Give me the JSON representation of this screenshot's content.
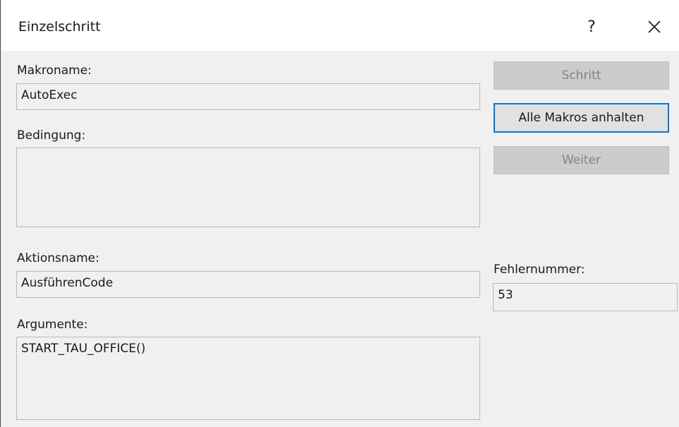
{
  "window": {
    "title": "Einzelschritt",
    "help_label": "?",
    "close_icon": "close-icon"
  },
  "fields": {
    "makroname_label": "Makroname:",
    "makroname_value": "AutoExec",
    "bedingung_label": "Bedingung:",
    "bedingung_value": "",
    "aktionsname_label": "Aktionsname:",
    "aktionsname_value": "AusführenCode",
    "argumente_label": "Argumente:",
    "argumente_value": "START_TAU_OFFICE()",
    "fehlernummer_label": "Fehlernummer:",
    "fehlernummer_value": "53"
  },
  "buttons": {
    "schritt": "Schritt",
    "alle_anhalten": "Alle Makros anhalten",
    "weiter": "Weiter"
  },
  "colors": {
    "accent": "#0078d7",
    "disabled_bg": "#cccccc",
    "disabled_text": "#838383"
  }
}
